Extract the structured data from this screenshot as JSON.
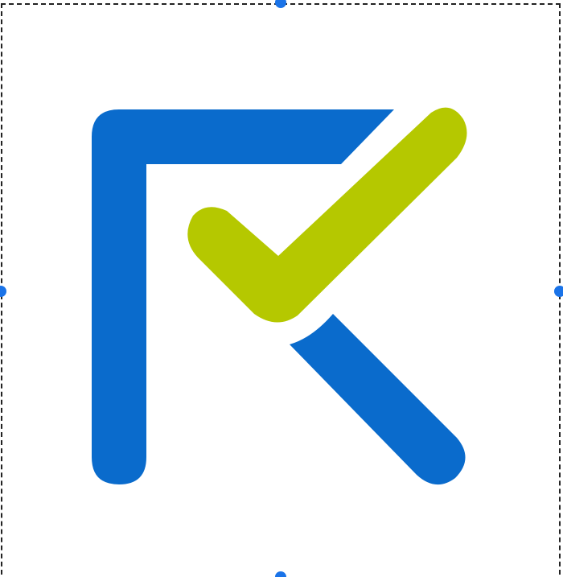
{
  "canvas": {
    "background": "#ffffff"
  },
  "selection": {
    "border_style": "dashed",
    "border_color": "#222222",
    "handle_color": "#1a73e8",
    "handles": [
      "top-center",
      "middle-left",
      "middle-right",
      "bottom-center"
    ]
  },
  "logo": {
    "description_icon": "rk-checkmark-logo-icon",
    "primary_color": "#0a6bcc",
    "accent_color": "#b5c800"
  }
}
